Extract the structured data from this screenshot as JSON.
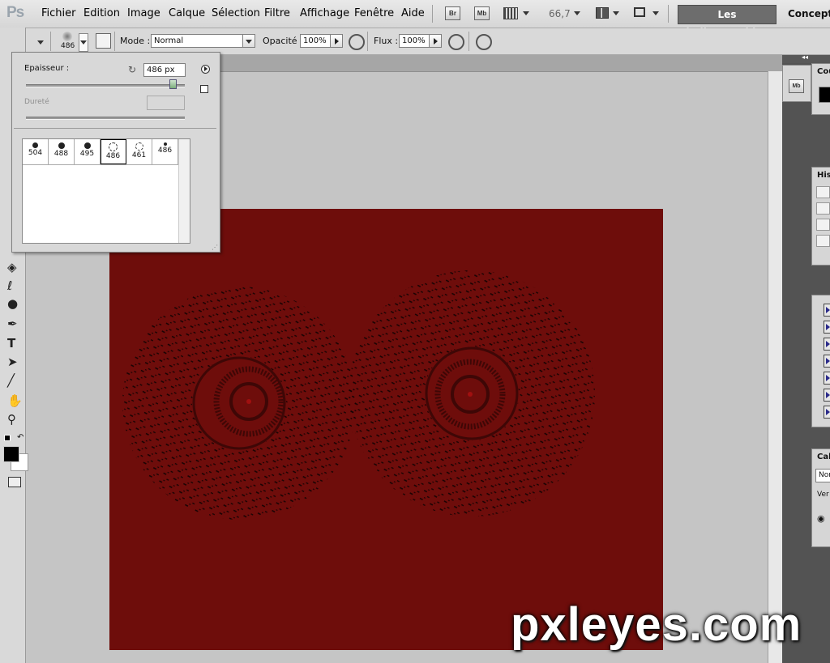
{
  "app": {
    "logo": "Ps"
  },
  "menubar": {
    "items": [
      "Fichier",
      "Edition",
      "Image",
      "Calque",
      "Sélection",
      "Filtre",
      "Affichage",
      "Fenêtre",
      "Aide"
    ],
    "bridge": "Br",
    "mini_bridge": "Mb",
    "zoom": "66,7",
    "workspace_active": "Les indispensables",
    "workspace_next": "Conceptio"
  },
  "options": {
    "brush_size": "486",
    "mode_label": "Mode :",
    "mode_value": "Normal",
    "opacity_label": "Opacité :",
    "opacity_value": "100%",
    "flow_label": "Flux :",
    "flow_value": "100%"
  },
  "brush_panel": {
    "size_label": "Epaisseur :",
    "size_value": "486 px",
    "size_fraction": 0.92,
    "hardness_label": "Dureté",
    "presets": [
      "504",
      "488",
      "495",
      "486",
      "461",
      "486"
    ],
    "selected_preset": 3
  },
  "right_panels": {
    "color_tab": "Cou",
    "mb_icon": "Mb",
    "history_tab": "Hist",
    "layers_tab": "Cal",
    "blend_value": "Nor",
    "lock_label": "Ver"
  },
  "canvas": {
    "color": "#6e0d0b"
  },
  "watermark": "pxleyes.com"
}
